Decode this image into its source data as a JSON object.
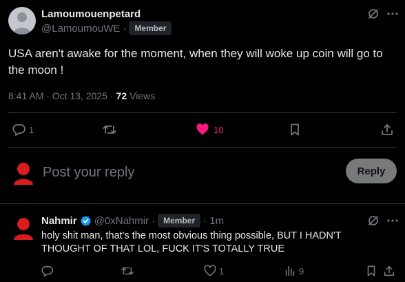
{
  "post": {
    "author_name": "Lamoumouenpetard",
    "handle": "@LamoumouWE",
    "separator": "·",
    "badge": "Member",
    "text": "USA aren't awake for the moment, when they will woke up coin will go to the moon !",
    "time": "8:41 AM · Oct 13, 2025 ·",
    "views_count": "72",
    "views_label": "Views",
    "replies": "1",
    "likes": "10",
    "liked": true,
    "like_color": "#f91880"
  },
  "composer": {
    "placeholder": "Post your reply",
    "reply_button": "Reply"
  },
  "reply": {
    "author_name": "Nahmir",
    "verified": true,
    "verified_color": "#1d9bf0",
    "handle": "@0xNahmir",
    "separator": "·",
    "badge": "Member",
    "age": "· 1m",
    "text": "holy shit man, that's the most obvious thing possible, BUT I HADN'T THOUGHT OF THAT LOL, FUCK IT'S TOTALLY TRUE",
    "likes": "1",
    "views": "9"
  },
  "colors": {
    "avatar_red": "#d91d1d",
    "avatar_gray": "#c4c8cc",
    "divider": "#2f3336"
  }
}
